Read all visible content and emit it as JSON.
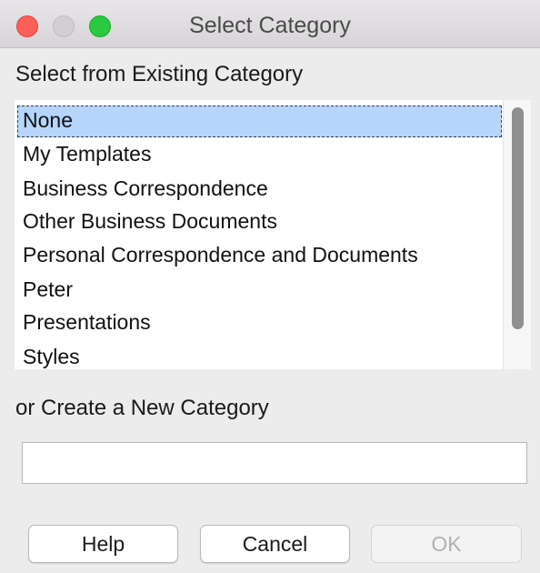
{
  "window": {
    "title": "Select Category"
  },
  "existing": {
    "label": "Select from Existing Category",
    "items": [
      "None",
      "My Templates",
      "Business Correspondence",
      "Other Business Documents",
      "Personal Correspondence and Documents",
      "Peter",
      "Presentations",
      "Styles"
    ],
    "selected": "None"
  },
  "create": {
    "label": "or Create a New Category",
    "value": ""
  },
  "buttons": {
    "help": "Help",
    "cancel": "Cancel",
    "ok": "OK"
  },
  "colors": {
    "close": "#fc5f57",
    "zoom": "#2ac940",
    "selection": "#b5d5fb"
  }
}
